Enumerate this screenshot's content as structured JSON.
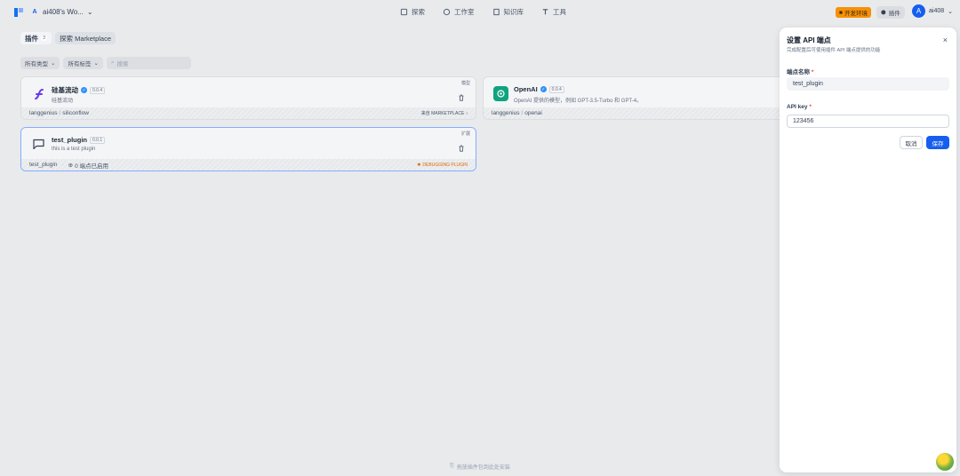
{
  "header": {
    "workspace_initial": "A",
    "workspace_name": "ai408's Wo...",
    "nav": [
      {
        "icon": "compass-icon",
        "label": "探索"
      },
      {
        "icon": "workflow-icon",
        "label": "工作室"
      },
      {
        "icon": "book-icon",
        "label": "知识库"
      },
      {
        "icon": "tools-icon",
        "label": "工具"
      }
    ],
    "env_badge": "开发环境",
    "plugin_button": "插件",
    "user_initial": "A",
    "user_name": "ai408"
  },
  "tabs": {
    "plugins_label": "插件",
    "plugins_count": "3",
    "marketplace_label": "探索 Marketplace"
  },
  "filters": {
    "type_label": "所有类型",
    "tag_label": "所有标签",
    "search_placeholder": "搜索"
  },
  "cards": [
    {
      "title": "硅基流动",
      "version": "0.0.4",
      "desc": "硅基流动",
      "type": "模型",
      "org": "langgenius",
      "name": "siliconflow",
      "source": "来自 MARKETPLACE"
    },
    {
      "title": "OpenAI",
      "version": "0.0.4",
      "desc": "OpenAI 提供的模型，例如 GPT-3.5-Turbo 和 GPT-4。",
      "type": "",
      "org": "langgenius",
      "name": "openai",
      "source": ""
    },
    {
      "title": "test_plugin",
      "version": "0.0.1",
      "desc": "this is a test plugin",
      "type": "扩展",
      "org": "test_plugin",
      "endpoints": "0 端点已启用",
      "source": "DEBUGGING PLUGIN"
    }
  ],
  "bottom_hint": "拖放插件包到此处安装",
  "panel": {
    "title": "设置 API 端点",
    "subtitle": "完成配置后可使用插件 API 端点提供的功能",
    "close": "×",
    "field1_label": "端点名称",
    "field1_value": "test_plugin",
    "field2_label": "API key",
    "field2_value": "123456",
    "required_mark": "*",
    "cancel": "取消",
    "save": "保存"
  },
  "colors": {
    "primary": "#155eef",
    "env_badge": "#f79009",
    "debug": "#dc6803",
    "required": "#f04438"
  }
}
